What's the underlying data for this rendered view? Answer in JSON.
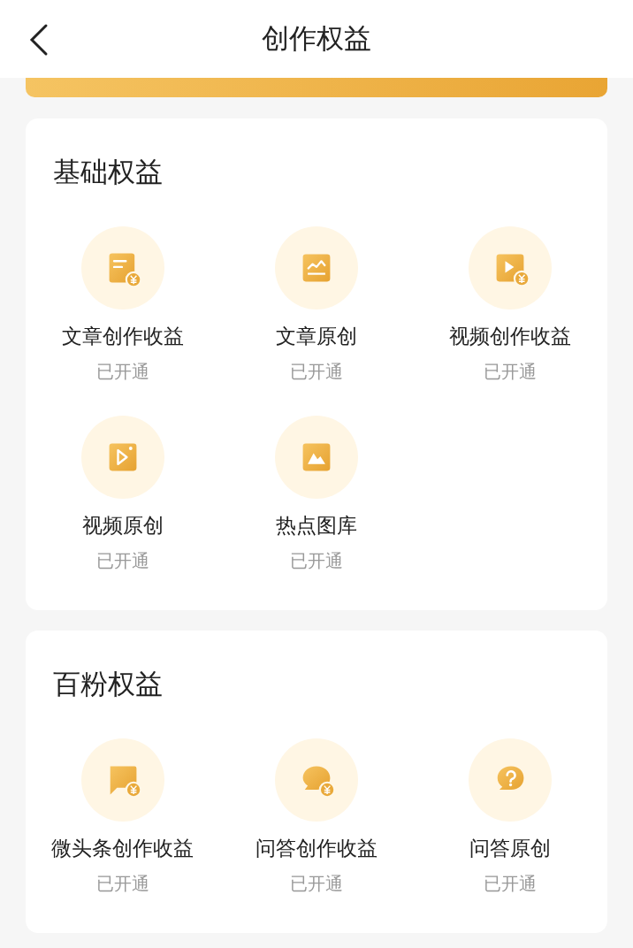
{
  "header": {
    "title": "创作权益"
  },
  "sections": [
    {
      "title": "基础权益",
      "items": [
        {
          "kind": "article-income",
          "label": "文章创作收益",
          "status": "已开通"
        },
        {
          "kind": "article-original",
          "label": "文章原创",
          "status": "已开通"
        },
        {
          "kind": "video-income",
          "label": "视频创作收益",
          "status": "已开通"
        },
        {
          "kind": "video-original",
          "label": "视频原创",
          "status": "已开通"
        },
        {
          "kind": "image-library",
          "label": "热点图库",
          "status": "已开通"
        }
      ]
    },
    {
      "title": "百粉权益",
      "items": [
        {
          "kind": "post-income",
          "label": "微头条创作收益",
          "status": "已开通"
        },
        {
          "kind": "qa-income",
          "label": "问答创作收益",
          "status": "已开通"
        },
        {
          "kind": "qa-original",
          "label": "问答原创",
          "status": "已开通"
        }
      ]
    }
  ]
}
